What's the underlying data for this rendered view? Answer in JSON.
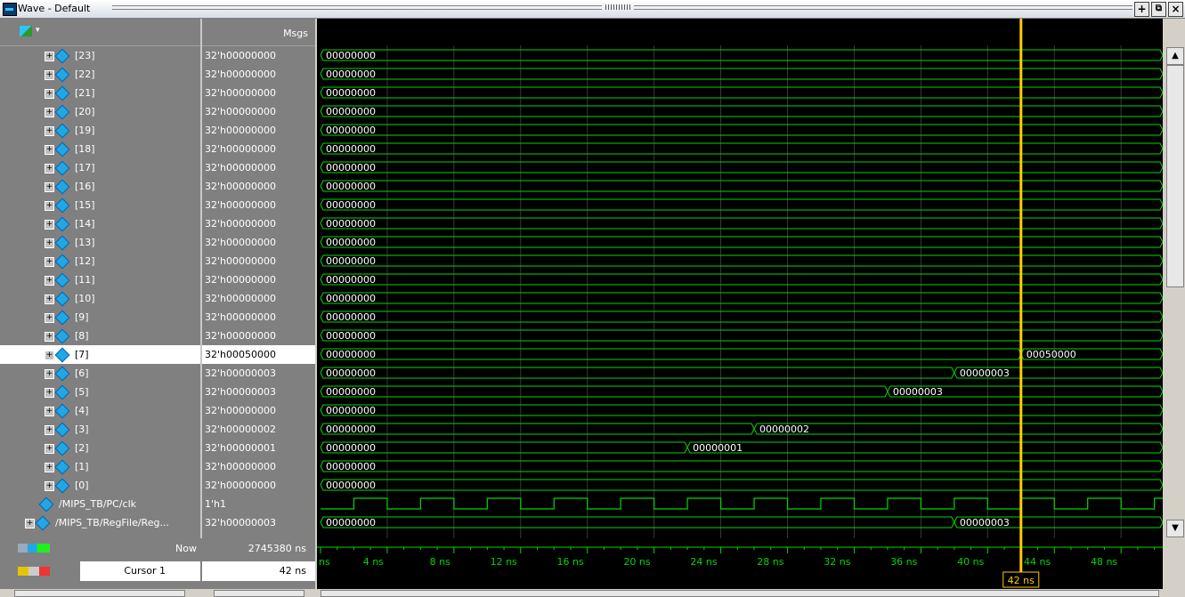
{
  "window": {
    "title": "Wave - Default"
  },
  "header": {
    "msgs_label": "Msgs",
    "toolbar_icon": "wave-add-icon"
  },
  "signals": [
    {
      "name": "[23]",
      "value": "32'h00000000",
      "expand": "+",
      "type": "bus"
    },
    {
      "name": "[22]",
      "value": "32'h00000000",
      "expand": "+",
      "type": "bus"
    },
    {
      "name": "[21]",
      "value": "32'h00000000",
      "expand": "+",
      "type": "bus"
    },
    {
      "name": "[20]",
      "value": "32'h00000000",
      "expand": "+",
      "type": "bus"
    },
    {
      "name": "[19]",
      "value": "32'h00000000",
      "expand": "+",
      "type": "bus"
    },
    {
      "name": "[18]",
      "value": "32'h00000000",
      "expand": "+",
      "type": "bus"
    },
    {
      "name": "[17]",
      "value": "32'h00000000",
      "expand": "+",
      "type": "bus"
    },
    {
      "name": "[16]",
      "value": "32'h00000000",
      "expand": "+",
      "type": "bus"
    },
    {
      "name": "[15]",
      "value": "32'h00000000",
      "expand": "+",
      "type": "bus"
    },
    {
      "name": "[14]",
      "value": "32'h00000000",
      "expand": "+",
      "type": "bus"
    },
    {
      "name": "[13]",
      "value": "32'h00000000",
      "expand": "+",
      "type": "bus"
    },
    {
      "name": "[12]",
      "value": "32'h00000000",
      "expand": "+",
      "type": "bus"
    },
    {
      "name": "[11]",
      "value": "32'h00000000",
      "expand": "+",
      "type": "bus"
    },
    {
      "name": "[10]",
      "value": "32'h00000000",
      "expand": "+",
      "type": "bus"
    },
    {
      "name": "[9]",
      "value": "32'h00000000",
      "expand": "+",
      "type": "bus"
    },
    {
      "name": "[8]",
      "value": "32'h00000000",
      "expand": "+",
      "type": "bus"
    },
    {
      "name": "[7]",
      "value": "32'h00050000",
      "expand": "+",
      "type": "bus",
      "selected": true
    },
    {
      "name": "[6]",
      "value": "32'h00000003",
      "expand": "+",
      "type": "bus"
    },
    {
      "name": "[5]",
      "value": "32'h00000003",
      "expand": "+",
      "type": "bus"
    },
    {
      "name": "[4]",
      "value": "32'h00000000",
      "expand": "+",
      "type": "bus"
    },
    {
      "name": "[3]",
      "value": "32'h00000002",
      "expand": "+",
      "type": "bus"
    },
    {
      "name": "[2]",
      "value": "32'h00000001",
      "expand": "+",
      "type": "bus"
    },
    {
      "name": "[1]",
      "value": "32'h00000000",
      "expand": "+",
      "type": "bus"
    },
    {
      "name": "[0]",
      "value": "32'h00000000",
      "expand": "+",
      "type": "bus"
    },
    {
      "name": "/MIPS_TB/PC/clk",
      "value": "1'h1",
      "expand": "",
      "type": "clk"
    },
    {
      "name": "/MIPS_TB/RegFile/Reg...",
      "value": "32'h00000003",
      "expand": "+",
      "type": "bus"
    }
  ],
  "waves": [
    {
      "segments": [
        {
          "t": 0,
          "v": "00000000"
        }
      ]
    },
    {
      "segments": [
        {
          "t": 0,
          "v": "00000000"
        }
      ]
    },
    {
      "segments": [
        {
          "t": 0,
          "v": "00000000"
        }
      ]
    },
    {
      "segments": [
        {
          "t": 0,
          "v": "00000000"
        }
      ]
    },
    {
      "segments": [
        {
          "t": 0,
          "v": "00000000"
        }
      ]
    },
    {
      "segments": [
        {
          "t": 0,
          "v": "00000000"
        }
      ]
    },
    {
      "segments": [
        {
          "t": 0,
          "v": "00000000"
        }
      ]
    },
    {
      "segments": [
        {
          "t": 0,
          "v": "00000000"
        }
      ]
    },
    {
      "segments": [
        {
          "t": 0,
          "v": "00000000"
        }
      ]
    },
    {
      "segments": [
        {
          "t": 0,
          "v": "00000000"
        }
      ]
    },
    {
      "segments": [
        {
          "t": 0,
          "v": "00000000"
        }
      ]
    },
    {
      "segments": [
        {
          "t": 0,
          "v": "00000000"
        }
      ]
    },
    {
      "segments": [
        {
          "t": 0,
          "v": "00000000"
        }
      ]
    },
    {
      "segments": [
        {
          "t": 0,
          "v": "00000000"
        }
      ]
    },
    {
      "segments": [
        {
          "t": 0,
          "v": "00000000"
        }
      ]
    },
    {
      "segments": [
        {
          "t": 0,
          "v": "00000000"
        }
      ]
    },
    {
      "segments": [
        {
          "t": 0,
          "v": "00000000"
        },
        {
          "t": 42,
          "v": "00050000"
        }
      ]
    },
    {
      "segments": [
        {
          "t": 0,
          "v": "00000000"
        },
        {
          "t": 38,
          "v": "00000003"
        }
      ]
    },
    {
      "segments": [
        {
          "t": 0,
          "v": "00000000"
        },
        {
          "t": 34,
          "v": "00000003"
        }
      ]
    },
    {
      "segments": [
        {
          "t": 0,
          "v": "00000000"
        }
      ]
    },
    {
      "segments": [
        {
          "t": 0,
          "v": "00000000"
        },
        {
          "t": 26,
          "v": "00000002"
        }
      ]
    },
    {
      "segments": [
        {
          "t": 0,
          "v": "00000000"
        },
        {
          "t": 22,
          "v": "00000001"
        }
      ]
    },
    {
      "segments": [
        {
          "t": 0,
          "v": "00000000"
        }
      ]
    },
    {
      "segments": [
        {
          "t": 0,
          "v": "00000000"
        }
      ]
    },
    {
      "clock": {
        "period": 4,
        "first_rise": 2
      }
    },
    {
      "segments": [
        {
          "t": 0,
          "v": "00000000"
        },
        {
          "t": 38,
          "v": "00000003"
        }
      ]
    }
  ],
  "timeline": {
    "start_ns": 0,
    "end_ns": 50.5,
    "first_label": "ns",
    "ticks": [
      {
        "t": 4,
        "label": "4 ns"
      },
      {
        "t": 8,
        "label": "8 ns"
      },
      {
        "t": 12,
        "label": "12 ns"
      },
      {
        "t": 16,
        "label": "16 ns"
      },
      {
        "t": 20,
        "label": "20 ns"
      },
      {
        "t": 24,
        "label": "24 ns"
      },
      {
        "t": 28,
        "label": "28 ns"
      },
      {
        "t": 32,
        "label": "32 ns"
      },
      {
        "t": 36,
        "label": "36 ns"
      },
      {
        "t": 40,
        "label": "40 ns"
      },
      {
        "t": 44,
        "label": "44 ns"
      },
      {
        "t": 48,
        "label": "48 ns"
      }
    ],
    "cursor_ns": 42,
    "cursor_label": "42 ns"
  },
  "status": {
    "now_label": "Now",
    "now_value": "2745380 ns",
    "cursor_name": "Cursor 1",
    "cursor_value": "42 ns"
  },
  "colors": {
    "wave": "#00d800",
    "label": "#ffffff",
    "cursor": "#ffcc00",
    "grid": "#3a3a3a",
    "timeline": "#00d800"
  }
}
